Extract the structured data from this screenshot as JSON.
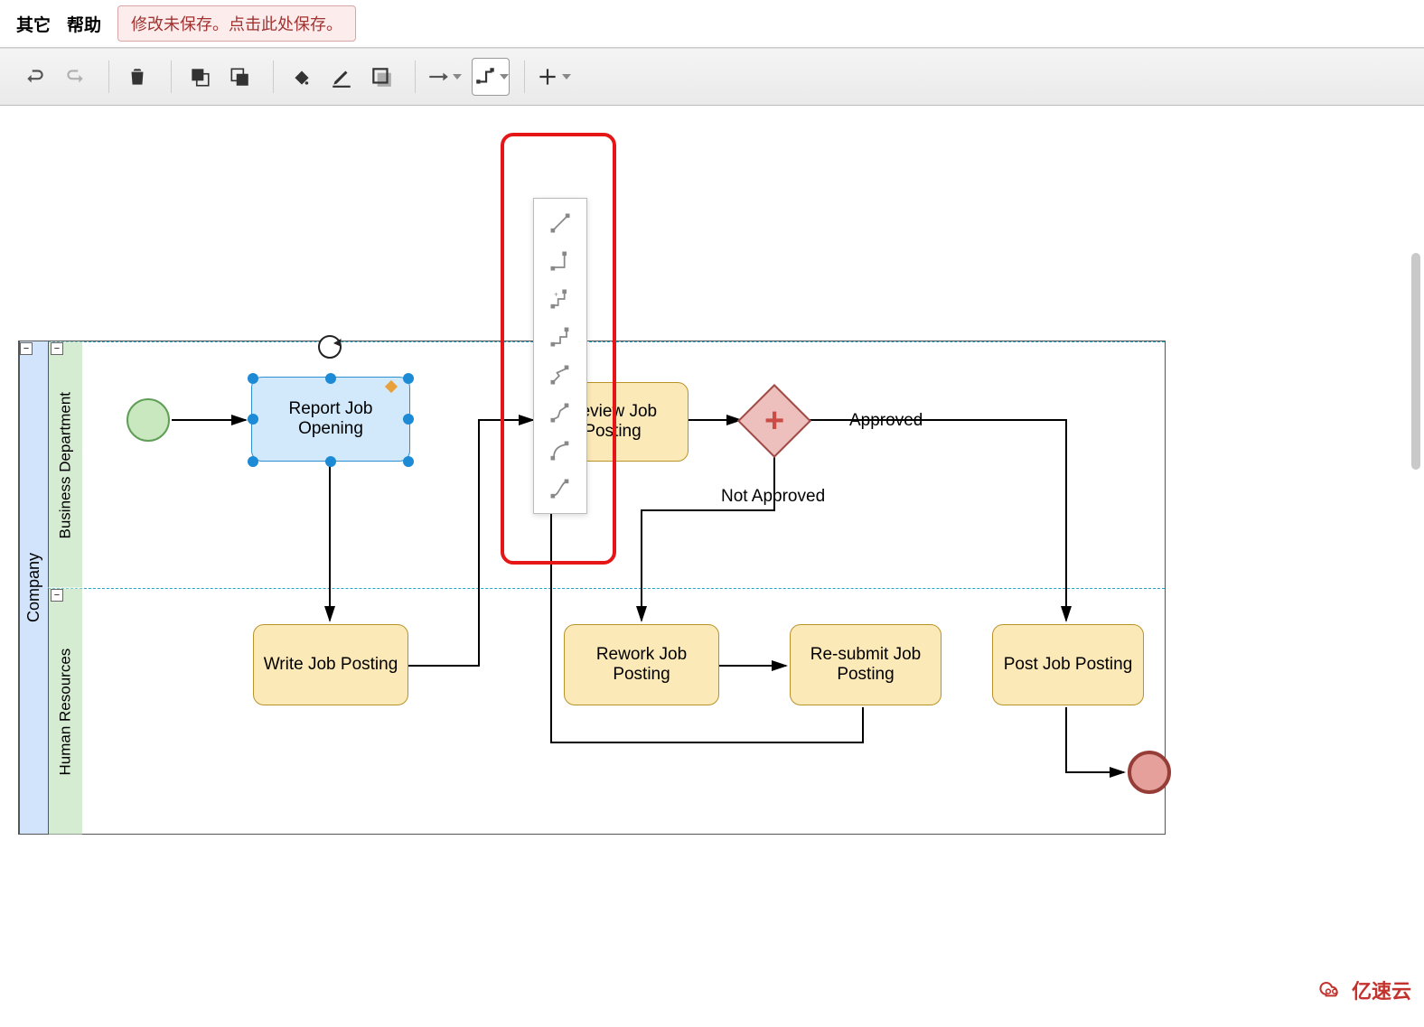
{
  "menu": {
    "other": "其它",
    "help": "帮助",
    "save_notice": "修改未保存。点击此处保存。"
  },
  "toolbar": {
    "undo": "undo",
    "redo": "redo",
    "delete": "delete",
    "to_front": "to-front",
    "to_back": "to-back",
    "fill": "fill-color",
    "line": "line-color",
    "shadow": "shadow",
    "connection": "connection-style",
    "waypoint": "waypoint-style",
    "add": "add"
  },
  "diagram": {
    "pool": "Company",
    "lane1": "Business Department",
    "lane2": "Human Resources",
    "start": "",
    "task_report": "Report Job Opening",
    "task_review": "Review Job Posting",
    "task_write": "Write Job Posting",
    "task_rework": "Rework Job Posting",
    "task_resubmit": "Re-submit Job Posting",
    "task_post": "Post Job Posting",
    "label_approved": "Approved",
    "label_notapproved": "Not Approved"
  },
  "connector_options": [
    "straight",
    "orthogonal",
    "orth-rounded",
    "elbow",
    "zigzag",
    "zigzag-rounded",
    "curved",
    "spline"
  ],
  "watermark": "亿速云"
}
